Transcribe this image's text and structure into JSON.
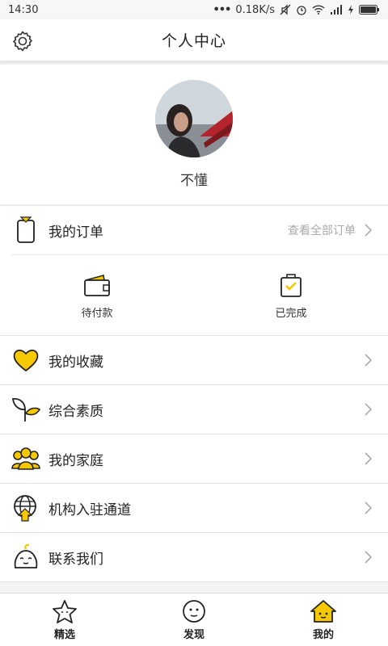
{
  "status_bar": {
    "time": "14:30",
    "network_speed": "0.18K/s"
  },
  "header": {
    "title": "个人中心",
    "settings_icon": "gear-icon"
  },
  "profile": {
    "username": "不懂"
  },
  "orders": {
    "label": "我的订单",
    "view_all": "查看全部订单",
    "statuses": [
      {
        "label": "待付款",
        "icon": "wallet-icon"
      },
      {
        "label": "已完成",
        "icon": "bag-check-icon"
      }
    ]
  },
  "menu": {
    "items": [
      {
        "label": "我的收藏",
        "icon": "heart-icon"
      },
      {
        "label": "综合素质",
        "icon": "sprout-icon"
      },
      {
        "label": "我的家庭",
        "icon": "family-icon"
      },
      {
        "label": "机构入驻通道",
        "icon": "globe-icon"
      },
      {
        "label": "联系我们",
        "icon": "smile-sprout-icon"
      }
    ]
  },
  "bottom_nav": {
    "items": [
      {
        "label": "精选",
        "icon": "star-icon"
      },
      {
        "label": "发现",
        "icon": "face-icon"
      },
      {
        "label": "我的",
        "icon": "house-icon",
        "active": true
      }
    ]
  },
  "colors": {
    "accent_yellow": "#f5c800",
    "line": "#222222",
    "muted": "#aaaaaa"
  }
}
